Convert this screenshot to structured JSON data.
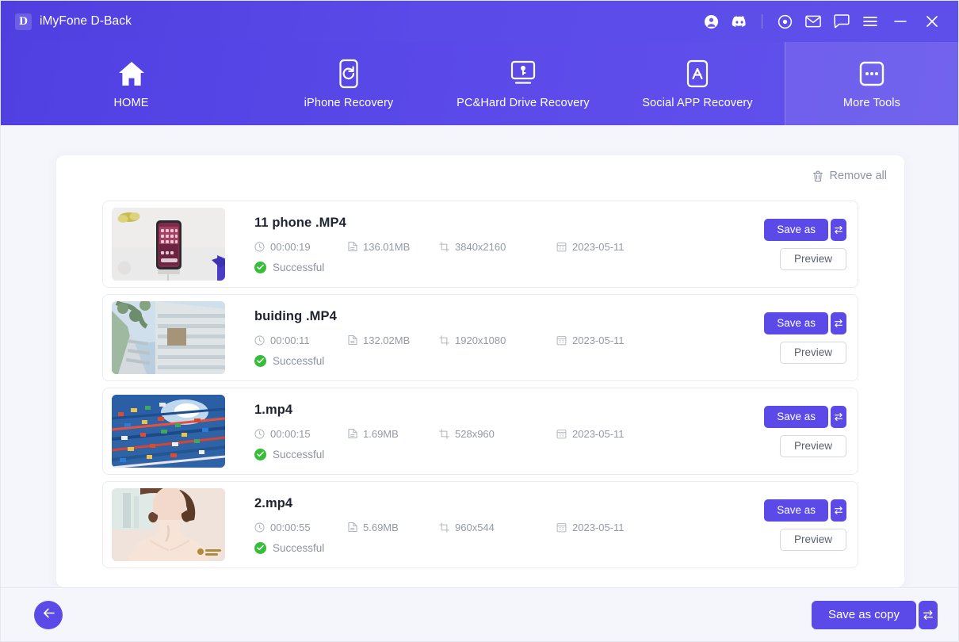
{
  "window": {
    "brand_initial": "D",
    "title": "iMyFone D-Back",
    "controls": [
      {
        "name": "account-icon",
        "label": "Account"
      },
      {
        "name": "discord-icon",
        "label": "Discord"
      },
      {
        "name": "target-icon",
        "label": "Record"
      },
      {
        "name": "mail-icon",
        "label": "Mail"
      },
      {
        "name": "chat-icon",
        "label": "Feedback"
      },
      {
        "name": "menu-icon",
        "label": "Menu"
      },
      {
        "name": "minimize-icon",
        "label": "Minimize"
      },
      {
        "name": "close-icon",
        "label": "Close"
      }
    ]
  },
  "nav": {
    "items": [
      {
        "label": "HOME",
        "icon": "home-icon",
        "active": false
      },
      {
        "label": "iPhone Recovery",
        "icon": "phone-refresh-icon",
        "active": false
      },
      {
        "label": "PC&Hard Drive Recovery",
        "icon": "monitor-key-icon",
        "active": false
      },
      {
        "label": "Social APP Recovery",
        "icon": "app-store-icon",
        "active": false
      },
      {
        "label": "More Tools",
        "icon": "ellipsis-box-icon",
        "active": true
      }
    ]
  },
  "toolbar": {
    "remove_all_label": "Remove all",
    "remove_all_icon": "trash-icon"
  },
  "files": [
    {
      "name": "11 phone .MP4",
      "duration": "00:00:19",
      "size": "136.01MB",
      "resolution": "3840x2160",
      "date": "2023-05-11",
      "status": "Successful",
      "save_label": "Save as",
      "preview_label": "Preview",
      "thumbnail": "phone-on-desk"
    },
    {
      "name": "buiding .MP4",
      "duration": "00:00:11",
      "size": "132.02MB",
      "resolution": "1920x1080",
      "date": "2023-05-11",
      "status": "Successful",
      "save_label": "Save as",
      "preview_label": "Preview",
      "thumbnail": "building-facade"
    },
    {
      "name": "1.mp4",
      "duration": "00:00:15",
      "size": "1.69MB",
      "resolution": "528x960",
      "date": "2023-05-11",
      "status": "Successful",
      "save_label": "Save as",
      "preview_label": "Preview",
      "thumbnail": "colorful-flags-water"
    },
    {
      "name": "2.mp4",
      "duration": "00:00:55",
      "size": "5.69MB",
      "resolution": "960x544",
      "date": "2023-05-11",
      "status": "Successful",
      "save_label": "Save as",
      "preview_label": "Preview",
      "thumbnail": "woman-portrait"
    }
  ],
  "footer": {
    "back_icon": "arrow-left-icon",
    "save_copy_label": "Save as copy",
    "dropdown_icon": "swap-arrows-icon"
  },
  "colors": {
    "accent": "#5b4ae8",
    "header_gradient_start": "#4f3fe0",
    "header_gradient_end": "#6252ec",
    "page_background": "#f4f6fb",
    "success": "#36bd3a",
    "muted_text": "#9499a8"
  }
}
